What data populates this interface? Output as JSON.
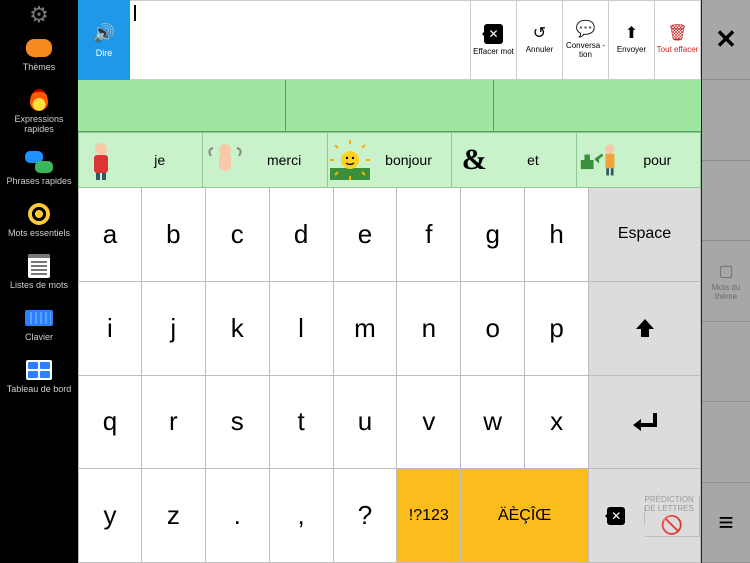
{
  "sidebar": {
    "gear": "gear",
    "items": [
      {
        "label": "Thèmes"
      },
      {
        "label": "Expressions rapides"
      },
      {
        "label": "Phrases rapides"
      },
      {
        "label": "Mots essentiels"
      },
      {
        "label": "Listes de mots"
      },
      {
        "label": "Clavier"
      },
      {
        "label": "Tableau de bord"
      }
    ]
  },
  "toprow": {
    "say_label": "Dire",
    "buttons": [
      {
        "label": "Effacer mot"
      },
      {
        "label": "Annuler"
      },
      {
        "label": "Conversa - tion"
      },
      {
        "label": "Envoyer"
      },
      {
        "label": "Tout effacer"
      }
    ]
  },
  "suggestions": [
    {
      "word": "je"
    },
    {
      "word": "merci"
    },
    {
      "word": "bonjour"
    },
    {
      "word": "et"
    },
    {
      "word": "pour"
    }
  ],
  "keyboard": {
    "rows": [
      [
        "a",
        "b",
        "c",
        "d",
        "e",
        "f",
        "g",
        "h"
      ],
      [
        "i",
        "j",
        "k",
        "l",
        "m",
        "n",
        "o",
        "p"
      ],
      [
        "q",
        "r",
        "s",
        "t",
        "u",
        "v",
        "w",
        "x"
      ],
      [
        "y",
        "z",
        ".",
        ",",
        "?"
      ]
    ],
    "side": [
      "Espace",
      "shift",
      "enter"
    ],
    "bottom_special": [
      "!?123",
      "ÄÈÇÎŒ"
    ],
    "prediction_label": "PRÉDICTION DE LETTRES"
  },
  "rightbar": {
    "close": "✕",
    "theme_words": "Mots du thème",
    "menu": "≡"
  }
}
